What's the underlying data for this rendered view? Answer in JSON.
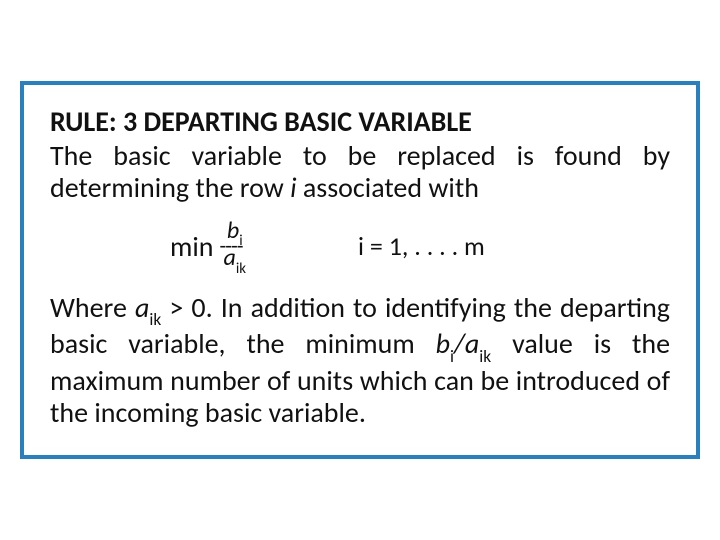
{
  "title": "RULE: 3 DEPARTING BASIC VARIABLE",
  "intro_a": "The basic variable to be replaced is found by determining the row ",
  "intro_i": "i",
  "intro_b": " associated with",
  "min_label": "min",
  "frac_num_base": "b",
  "frac_num_sub": "i",
  "frac_den_base": "a",
  "frac_den_sub": "ik",
  "frac_bar": "----",
  "range": "i = 1, .  .  .  .  m",
  "where_a": "Where ",
  "where_aik_base": "a",
  "where_aik_sub": "ik",
  "where_b": " > 0. In addition to identifying the departing basic variable, the minimum ",
  "where_bi_base": "b",
  "where_bi_sub": "i",
  "where_slash": "/",
  "where_aik2_base": "a",
  "where_aik2_sub": "ik",
  "where_c": " value is the maximum number of units which can be introduced of the incoming basic variable."
}
